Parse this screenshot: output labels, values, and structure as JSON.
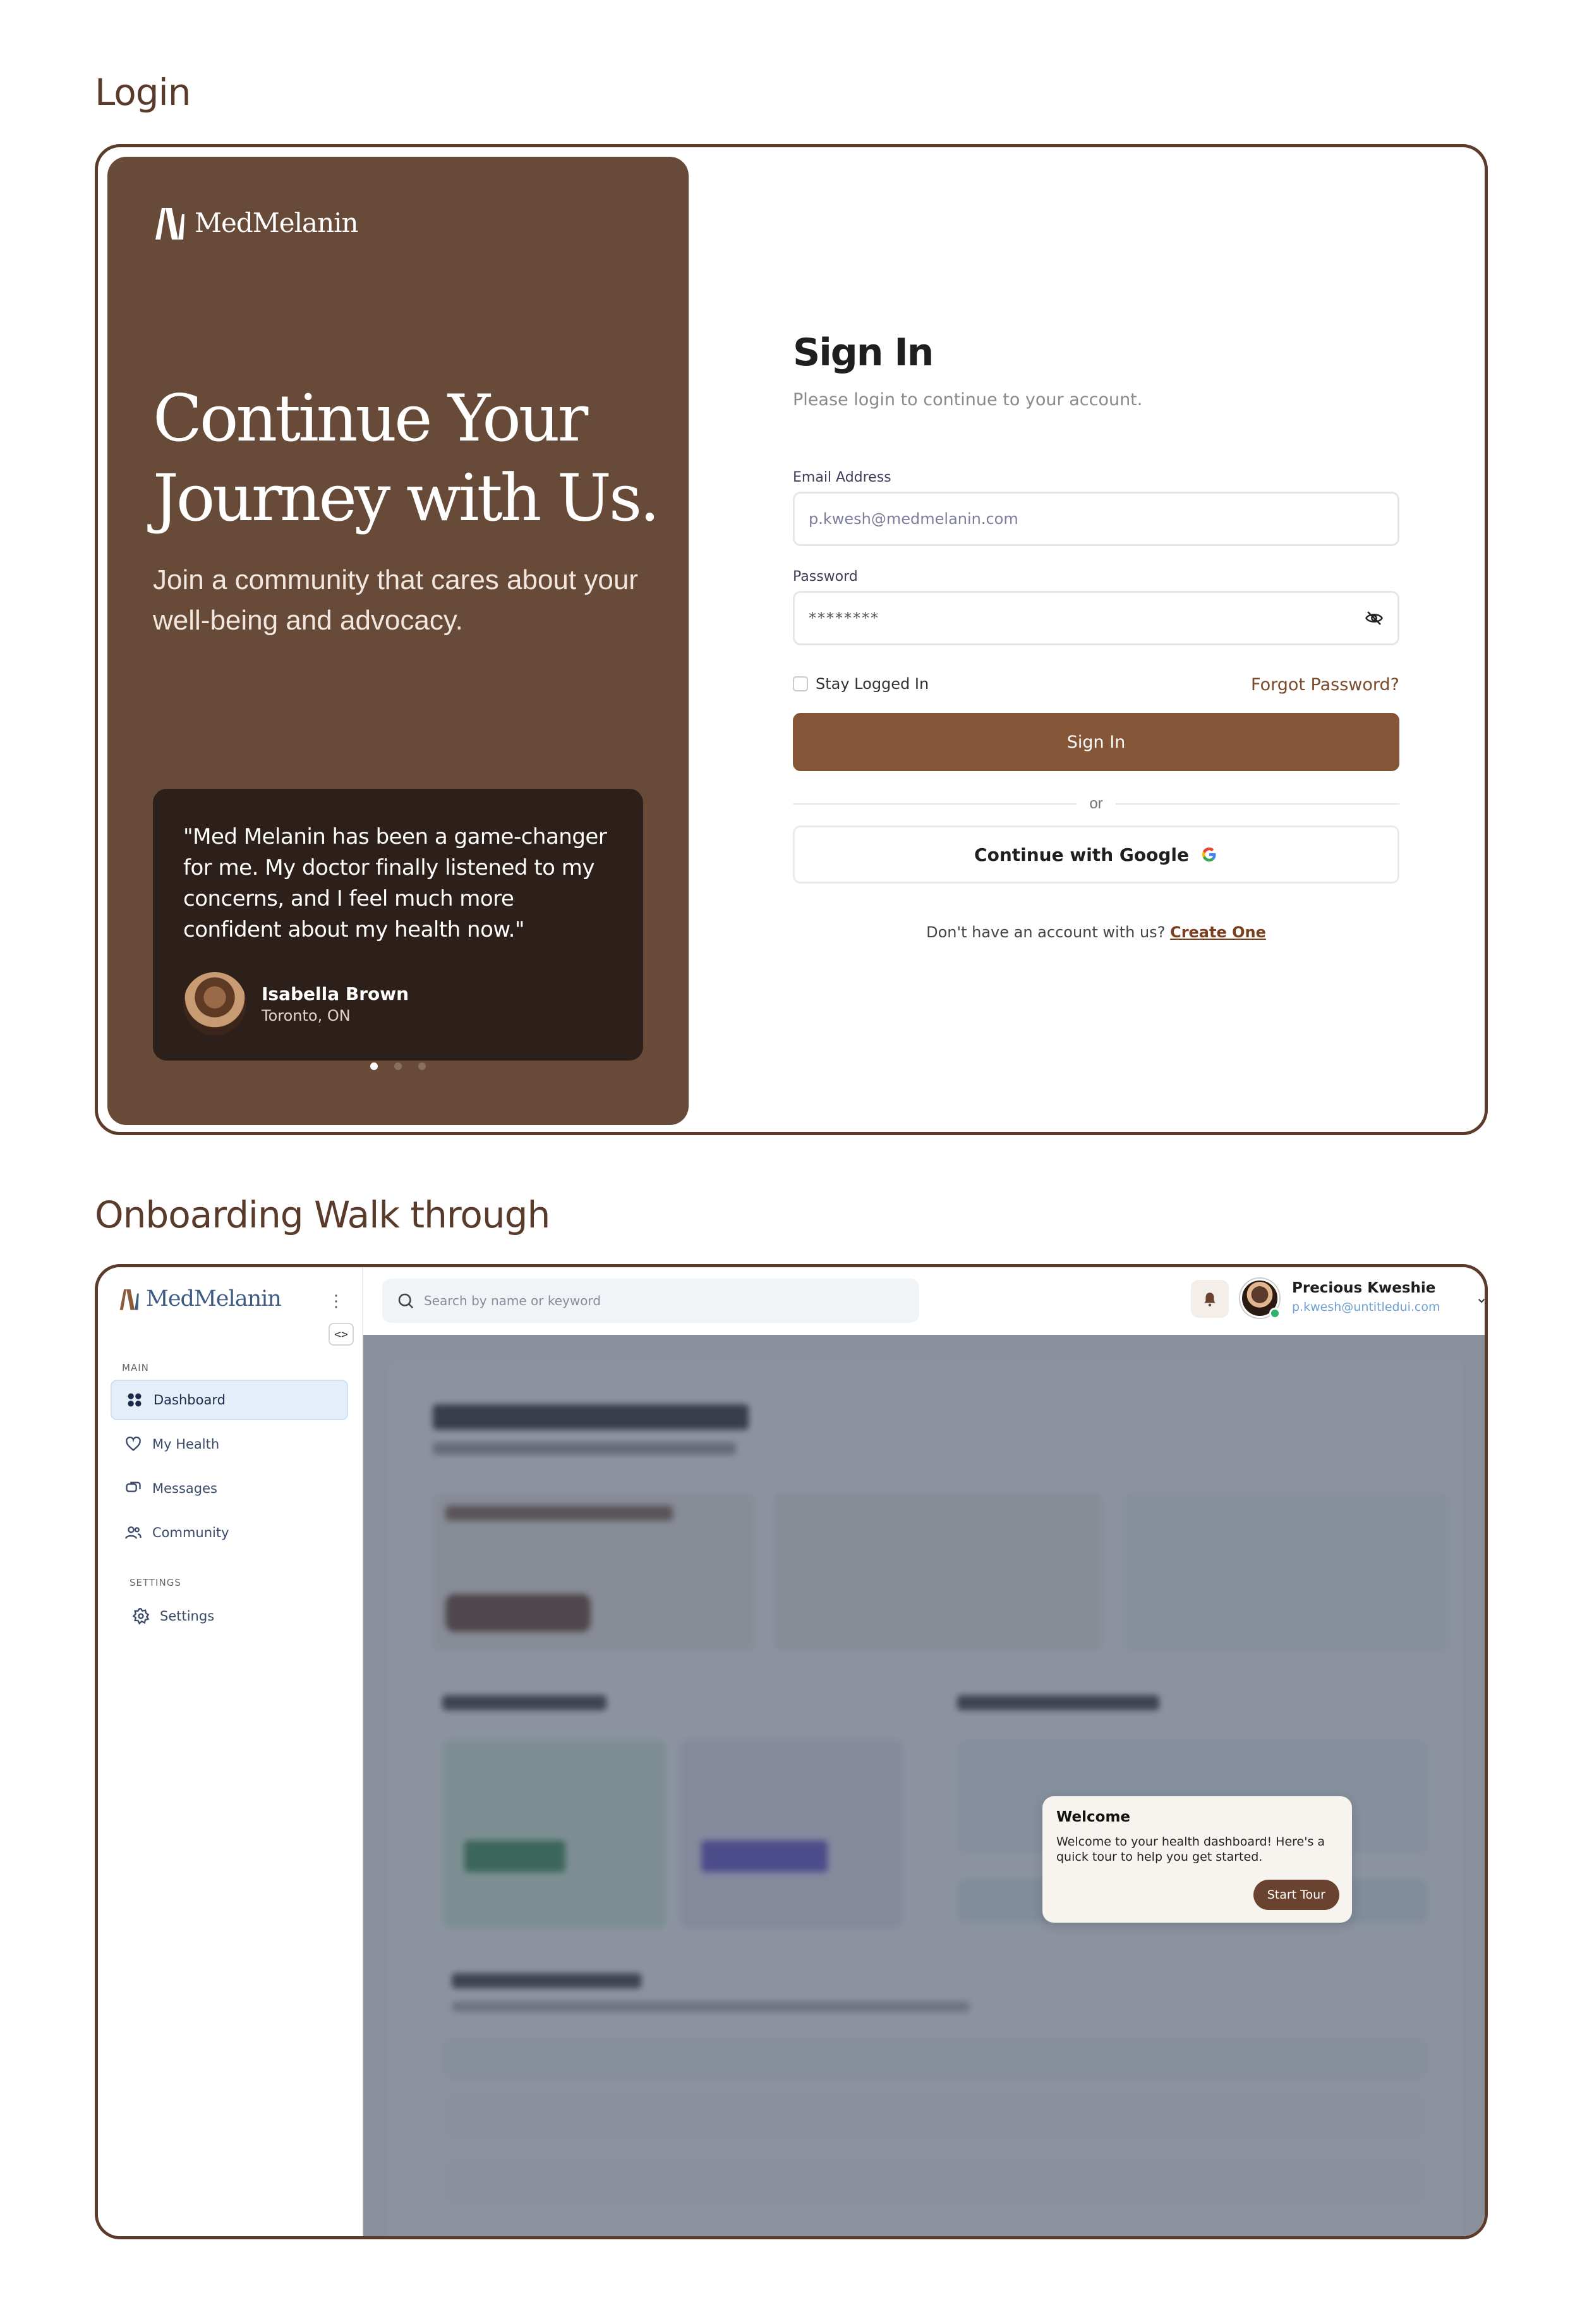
{
  "sections": {
    "login_title": "Login",
    "onboarding_title": "Onboarding Walk through"
  },
  "brand": {
    "name": "MedMelanin",
    "colors": {
      "brown": "#684a38",
      "dark": "#2d201b",
      "accent": "#845637",
      "frame": "#5c3b2b"
    }
  },
  "login": {
    "hero_title": "Continue Your Journey with Us.",
    "hero_subtitle": "Join a community that cares about your well-being and advocacy.",
    "testimonial": {
      "quote": "\"Med Melanin has been a game-changer for me. My doctor finally listened to my concerns, and I feel much more confident about my health now.\"",
      "author": "Isabella Brown",
      "location": "Toronto, ON"
    },
    "carousel": {
      "count": 3,
      "active": 1
    },
    "form": {
      "title": "Sign In",
      "subtitle": "Please login to continue to your account.",
      "email_label": "Email Address",
      "email_value": "p.kwesh@medmelanin.com",
      "password_label": "Password",
      "password_value": "********",
      "remember_label": "Stay Logged In",
      "forgot_label": "Forgot Password?",
      "submit_label": "Sign In",
      "divider": "or",
      "google_label": "Continue with Google",
      "no_account_text": "Don't have an account with us?",
      "create_label": "Create One"
    }
  },
  "onboarding": {
    "sidebar": {
      "brand": "MedMelanin",
      "main_heading": "MAIN",
      "items": [
        {
          "label": "Dashboard",
          "icon": "grid-icon"
        },
        {
          "label": "My Health",
          "icon": "heart-icon"
        },
        {
          "label": "Messages",
          "icon": "chat-icon"
        },
        {
          "label": "Community",
          "icon": "users-icon"
        }
      ],
      "settings_heading": "SETTINGS",
      "settings_item": {
        "label": "Settings",
        "icon": "gear-icon"
      }
    },
    "topbar": {
      "search_placeholder": "Search by name or keyword",
      "user_name": "Precious Kweshie",
      "user_email": "p.kwesh@untitledui.com"
    },
    "tour": {
      "title": "Welcome",
      "body": "Welcome to your health dashboard! Here's a quick tour to help you get started.",
      "button": "Start Tour"
    }
  }
}
